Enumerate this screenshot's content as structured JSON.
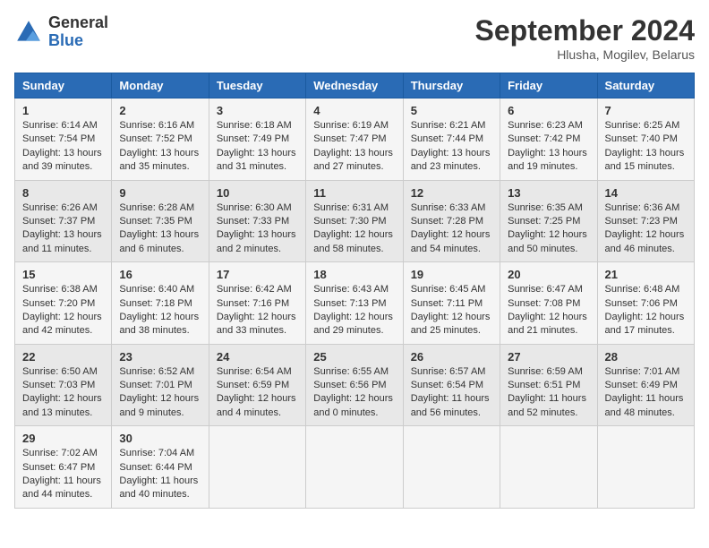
{
  "header": {
    "logo_general": "General",
    "logo_blue": "Blue",
    "month_year": "September 2024",
    "location": "Hlusha, Mogilev, Belarus"
  },
  "days_of_week": [
    "Sunday",
    "Monday",
    "Tuesday",
    "Wednesday",
    "Thursday",
    "Friday",
    "Saturday"
  ],
  "weeks": [
    [
      {
        "day": "1",
        "sunrise": "6:14 AM",
        "sunset": "7:54 PM",
        "daylight": "13 hours and 39 minutes."
      },
      {
        "day": "2",
        "sunrise": "6:16 AM",
        "sunset": "7:52 PM",
        "daylight": "13 hours and 35 minutes."
      },
      {
        "day": "3",
        "sunrise": "6:18 AM",
        "sunset": "7:49 PM",
        "daylight": "13 hours and 31 minutes."
      },
      {
        "day": "4",
        "sunrise": "6:19 AM",
        "sunset": "7:47 PM",
        "daylight": "13 hours and 27 minutes."
      },
      {
        "day": "5",
        "sunrise": "6:21 AM",
        "sunset": "7:44 PM",
        "daylight": "13 hours and 23 minutes."
      },
      {
        "day": "6",
        "sunrise": "6:23 AM",
        "sunset": "7:42 PM",
        "daylight": "13 hours and 19 minutes."
      },
      {
        "day": "7",
        "sunrise": "6:25 AM",
        "sunset": "7:40 PM",
        "daylight": "13 hours and 15 minutes."
      }
    ],
    [
      {
        "day": "8",
        "sunrise": "6:26 AM",
        "sunset": "7:37 PM",
        "daylight": "13 hours and 11 minutes."
      },
      {
        "day": "9",
        "sunrise": "6:28 AM",
        "sunset": "7:35 PM",
        "daylight": "13 hours and 6 minutes."
      },
      {
        "day": "10",
        "sunrise": "6:30 AM",
        "sunset": "7:33 PM",
        "daylight": "13 hours and 2 minutes."
      },
      {
        "day": "11",
        "sunrise": "6:31 AM",
        "sunset": "7:30 PM",
        "daylight": "12 hours and 58 minutes."
      },
      {
        "day": "12",
        "sunrise": "6:33 AM",
        "sunset": "7:28 PM",
        "daylight": "12 hours and 54 minutes."
      },
      {
        "day": "13",
        "sunrise": "6:35 AM",
        "sunset": "7:25 PM",
        "daylight": "12 hours and 50 minutes."
      },
      {
        "day": "14",
        "sunrise": "6:36 AM",
        "sunset": "7:23 PM",
        "daylight": "12 hours and 46 minutes."
      }
    ],
    [
      {
        "day": "15",
        "sunrise": "6:38 AM",
        "sunset": "7:20 PM",
        "daylight": "12 hours and 42 minutes."
      },
      {
        "day": "16",
        "sunrise": "6:40 AM",
        "sunset": "7:18 PM",
        "daylight": "12 hours and 38 minutes."
      },
      {
        "day": "17",
        "sunrise": "6:42 AM",
        "sunset": "7:16 PM",
        "daylight": "12 hours and 33 minutes."
      },
      {
        "day": "18",
        "sunrise": "6:43 AM",
        "sunset": "7:13 PM",
        "daylight": "12 hours and 29 minutes."
      },
      {
        "day": "19",
        "sunrise": "6:45 AM",
        "sunset": "7:11 PM",
        "daylight": "12 hours and 25 minutes."
      },
      {
        "day": "20",
        "sunrise": "6:47 AM",
        "sunset": "7:08 PM",
        "daylight": "12 hours and 21 minutes."
      },
      {
        "day": "21",
        "sunrise": "6:48 AM",
        "sunset": "7:06 PM",
        "daylight": "12 hours and 17 minutes."
      }
    ],
    [
      {
        "day": "22",
        "sunrise": "6:50 AM",
        "sunset": "7:03 PM",
        "daylight": "12 hours and 13 minutes."
      },
      {
        "day": "23",
        "sunrise": "6:52 AM",
        "sunset": "7:01 PM",
        "daylight": "12 hours and 9 minutes."
      },
      {
        "day": "24",
        "sunrise": "6:54 AM",
        "sunset": "6:59 PM",
        "daylight": "12 hours and 4 minutes."
      },
      {
        "day": "25",
        "sunrise": "6:55 AM",
        "sunset": "6:56 PM",
        "daylight": "12 hours and 0 minutes."
      },
      {
        "day": "26",
        "sunrise": "6:57 AM",
        "sunset": "6:54 PM",
        "daylight": "11 hours and 56 minutes."
      },
      {
        "day": "27",
        "sunrise": "6:59 AM",
        "sunset": "6:51 PM",
        "daylight": "11 hours and 52 minutes."
      },
      {
        "day": "28",
        "sunrise": "7:01 AM",
        "sunset": "6:49 PM",
        "daylight": "11 hours and 48 minutes."
      }
    ],
    [
      {
        "day": "29",
        "sunrise": "7:02 AM",
        "sunset": "6:47 PM",
        "daylight": "11 hours and 44 minutes."
      },
      {
        "day": "30",
        "sunrise": "7:04 AM",
        "sunset": "6:44 PM",
        "daylight": "11 hours and 40 minutes."
      },
      null,
      null,
      null,
      null,
      null
    ]
  ]
}
